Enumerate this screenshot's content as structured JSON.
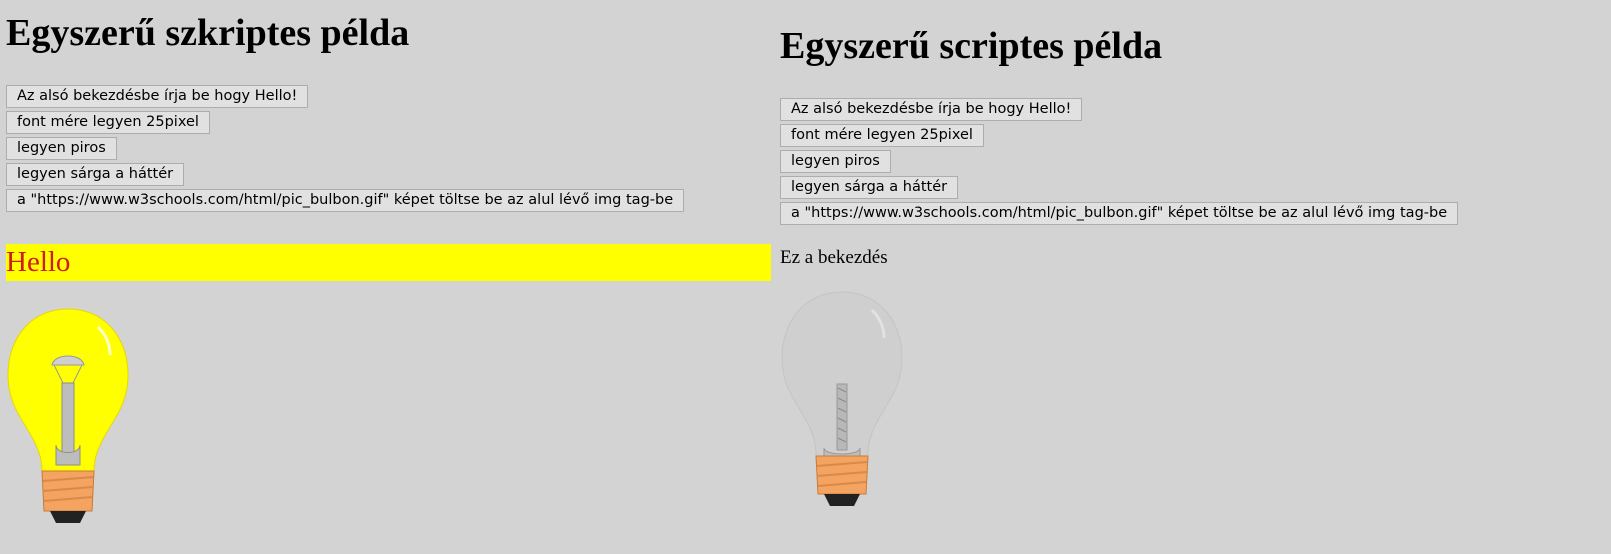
{
  "left": {
    "heading": "Egyszerű szkriptes példa",
    "buttons": [
      "Az alsó bekezdésbe írja be hogy Hello!",
      "font mére legyen 25pixel",
      "legyen piros",
      "legyen sárga a háttér",
      "a \"https://www.w3schools.com/html/pic_bulbon.gif\" képet töltse be az alul lévő img tag-be"
    ],
    "paragraph": "Hello",
    "image_state": "bulb-on"
  },
  "right": {
    "heading": "Egyszerű scriptes példa",
    "buttons": [
      "Az alsó bekezdésbe írja be hogy Hello!",
      "font mére legyen 25pixel",
      "legyen piros",
      "legyen sárga a háttér",
      "a \"https://www.w3schools.com/html/pic_bulbon.gif\" képet töltse be az alul lévő img tag-be"
    ],
    "paragraph": "Ez a bekezdés",
    "image_state": "bulb-off"
  },
  "colors": {
    "page_background": "#d3d3d3",
    "highlight_background": "#ffff00",
    "highlight_text": "#d11a1a",
    "bulb_on_glass": "#ffff00",
    "bulb_off_glass": "#cfcfcf",
    "bulb_base": "#f4a460"
  }
}
